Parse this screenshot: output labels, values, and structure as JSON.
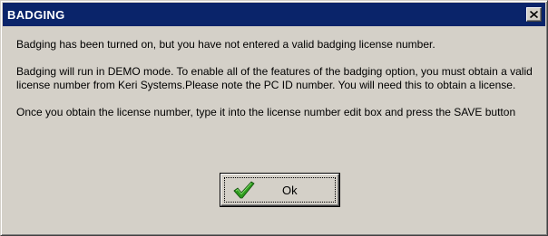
{
  "window": {
    "title": "BADGING",
    "close_icon": "close-icon"
  },
  "message": {
    "paragraphs": [
      "Badging has been turned on, but you have not entered a valid badging license number.",
      "Badging will run in DEMO mode.  To enable all of the features of the badging option, you must obtain a valid license number from Keri Systems.Please note the PC ID number.  You will need this to obtain a license.",
      "Once you obtain the license number, type it into the license number edit box and press the SAVE button"
    ]
  },
  "ok_button": {
    "label": "Ok",
    "icon": "checkmark-icon"
  },
  "colors": {
    "titlebar": "#0a246a",
    "face": "#d4d0c8",
    "check_green": "#2e9a1e"
  }
}
